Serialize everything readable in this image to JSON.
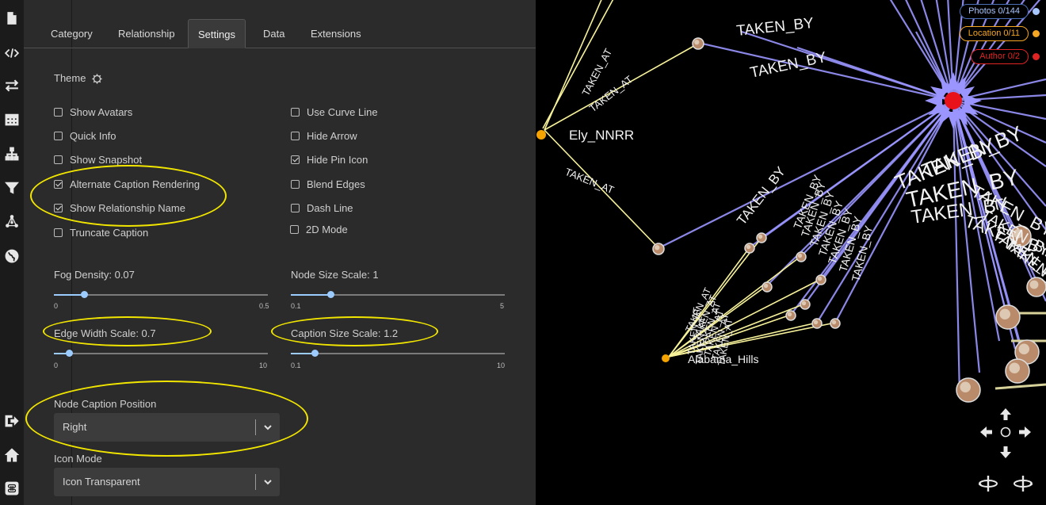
{
  "tabs": [
    {
      "label": "Category"
    },
    {
      "label": "Relationship"
    },
    {
      "label": "Settings"
    },
    {
      "label": "Data"
    },
    {
      "label": "Extensions"
    }
  ],
  "theme": {
    "label": "Theme"
  },
  "checkboxes_left": [
    {
      "label": "Show Avatars",
      "checked": false
    },
    {
      "label": "Quick Info",
      "checked": false
    },
    {
      "label": "Show Snapshot",
      "checked": false
    },
    {
      "label": "Alternate Caption Rendering",
      "checked": true
    },
    {
      "label": "Show Relationship Name",
      "checked": true
    },
    {
      "label": "Truncate Caption",
      "checked": false
    }
  ],
  "checkboxes_right": [
    {
      "label": "Use Curve Line",
      "checked": false
    },
    {
      "label": "Hide Arrow",
      "checked": false
    },
    {
      "label": "Hide Pin Icon",
      "checked": true
    },
    {
      "label": "Blend Edges",
      "checked": false
    },
    {
      "label": "Dash Line",
      "checked": false
    },
    {
      "label": "2D Mode",
      "checked": false
    }
  ],
  "sliders": {
    "fog": {
      "label": "Fog Density: 0.07",
      "min": "0",
      "max": "0.5",
      "value": 0.07,
      "minv": 0,
      "maxv": 0.5
    },
    "node_size": {
      "label": "Node Size Scale: 1",
      "min": "0.1",
      "max": "5",
      "value": 1,
      "minv": 0.1,
      "maxv": 5
    },
    "edge_width": {
      "label": "Edge Width Scale: 0.7",
      "min": "0",
      "max": "10",
      "value": 0.7,
      "minv": 0,
      "maxv": 10
    },
    "caption_size": {
      "label": "Caption Size Scale: 1.2",
      "min": "0.1",
      "max": "10",
      "value": 1.2,
      "minv": 0.1,
      "maxv": 10
    }
  },
  "node_caption_position": {
    "label": "Node Caption Position",
    "value": "Right"
  },
  "icon_mode": {
    "label": "Icon Mode",
    "value": "Icon Transparent"
  },
  "legend": [
    {
      "label": "Photos 0/144",
      "color": "#a9c7ff",
      "border": "#4a6fb5"
    },
    {
      "label": "Location 0/11",
      "color": "#f5a623",
      "border": "#f5a623"
    },
    {
      "label": "Author 0/2",
      "color": "#e02424",
      "border": "#e02424"
    }
  ],
  "graph": {
    "node_labels": {
      "ely": "Ely_NNRR",
      "alabama": "Alabama_Hills"
    },
    "edge_labels": {
      "taken_by": "TAKEN_BY",
      "taken_at": "TAKEN_AT"
    },
    "colors": {
      "taken_by": "#9b96ff",
      "taken_at": "#f7f29a",
      "author": "#e8121a",
      "location": "#f5a300"
    }
  },
  "icons": [
    "file-icon",
    "code-icon",
    "swap-icon",
    "table-icon",
    "hierarchy-icon",
    "filter-icon",
    "network-icon",
    "globe-icon",
    "sign-out-icon",
    "home-icon",
    "command-icon"
  ],
  "nav_icons": [
    "arrow-up-icon",
    "arrow-left-icon",
    "center-icon",
    "arrow-right-icon",
    "arrow-down-icon",
    "rotate-left-icon",
    "rotate-right-icon"
  ]
}
